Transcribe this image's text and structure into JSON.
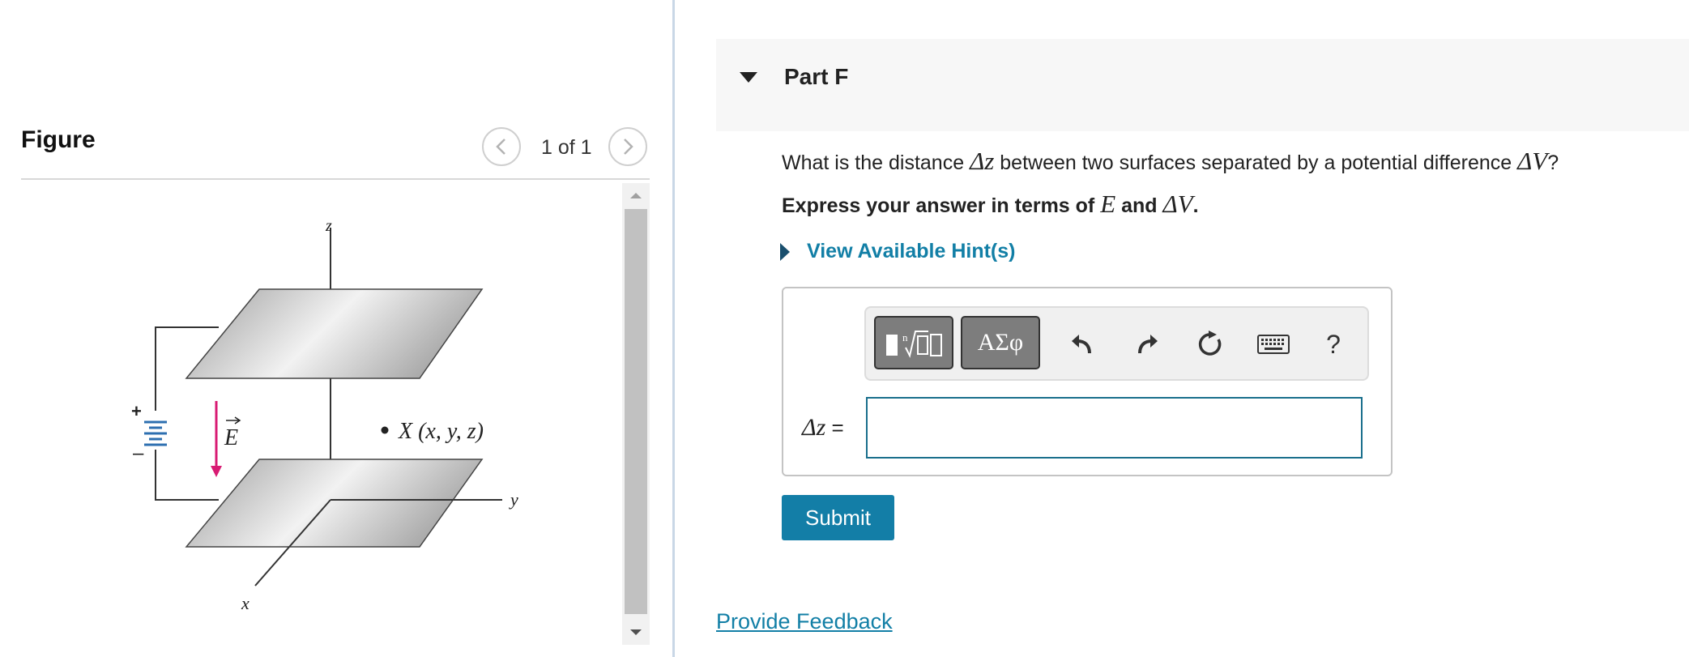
{
  "figure": {
    "title": "Figure",
    "page_counter": "1 of 1",
    "labels": {
      "z_axis": "z",
      "x_axis": "x",
      "y_axis": "y",
      "field_letter": "E",
      "point_label": "X (x, y, z)",
      "battery_plus": "+",
      "battery_minus": "–"
    },
    "colors": {
      "field_arrow": "#d81b73",
      "battery_plates": "#2d6fb0"
    }
  },
  "part": {
    "title": "Part F",
    "question": {
      "pre": "What is the distance ",
      "delta_z": "Δz",
      "mid": " between two surfaces separated by a potential difference ",
      "delta_v": "ΔV",
      "post": "?"
    },
    "instruction": {
      "pre": "Express your answer in terms of ",
      "e_var": "E",
      "and": " and ",
      "v_var": "ΔV",
      "post": "."
    },
    "hint_label": "View Available Hint(s)",
    "toolbar": {
      "symbols_label": "ΑΣφ",
      "help_label": "?"
    },
    "answer": {
      "label_var": "Δz",
      "label_eq": " =",
      "value": ""
    },
    "submit_label": "Submit"
  },
  "feedback_label": "Provide Feedback",
  "theme": {
    "accent": "#127fa6",
    "submit_bg": "#137ea7",
    "input_border": "#1a6f8c"
  }
}
